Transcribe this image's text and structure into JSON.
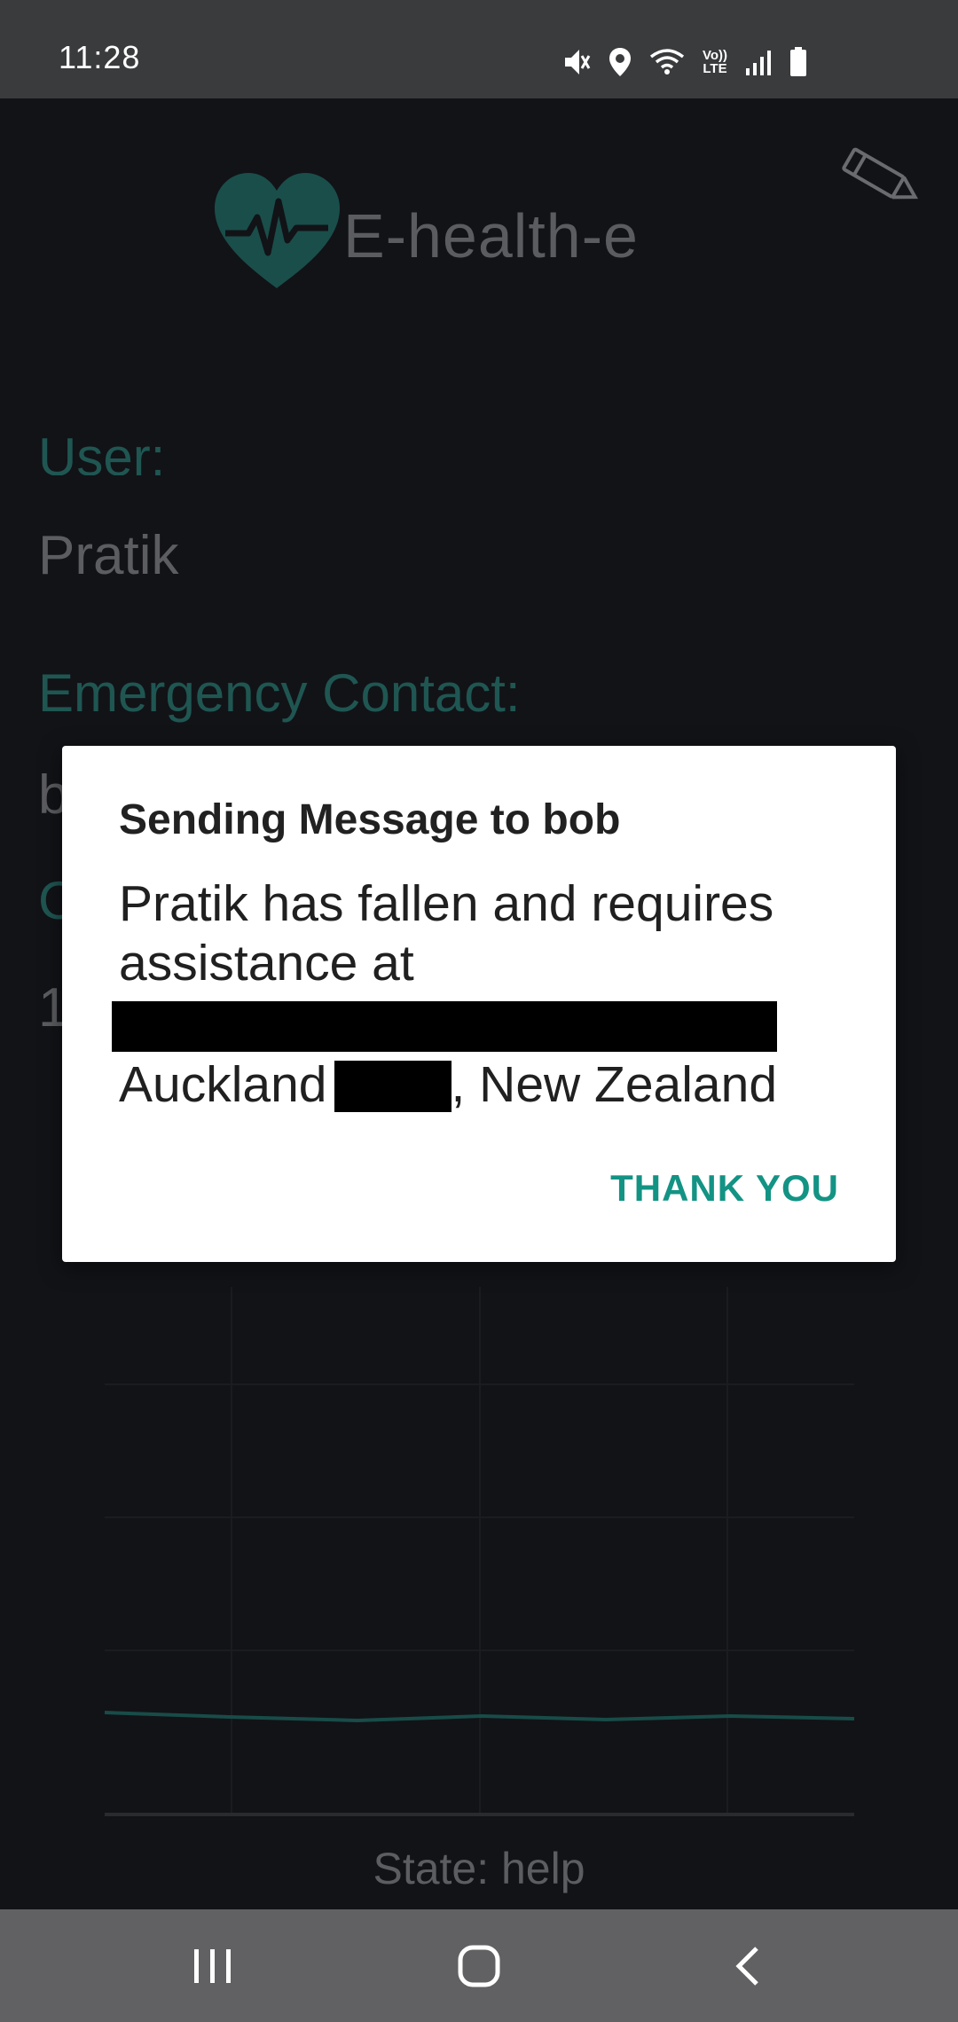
{
  "status_bar": {
    "time": "11:28",
    "network_label_top": "Vo))",
    "network_label_bottom": "LTE"
  },
  "app": {
    "logo_text": "E-health-e",
    "user_label": "User:",
    "user_value": "Pratik",
    "contact_label": "Emergency Contact:",
    "contact_value_partial": "b",
    "third_label_partial": "C",
    "third_value_partial": "1",
    "state_text": "State: help",
    "accent_color": "#1f5652"
  },
  "dialog": {
    "title": "Sending Message to bob",
    "message": "Pratik has fallen and requires assistance at",
    "location_city": "Auckland",
    "location_country": ", New Zealand",
    "action_label": "THANK YOU",
    "action_color": "#139384"
  },
  "nav_bar": {
    "buttons": [
      "recent-apps",
      "home",
      "back"
    ]
  }
}
